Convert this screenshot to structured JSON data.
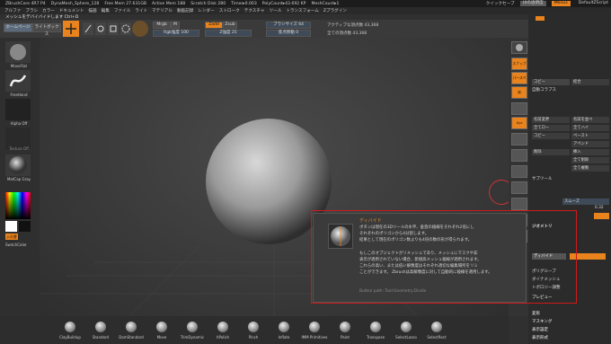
{
  "titlebar": {
    "app": "ZBrushCore 4R7 P4",
    "mesh": "DynaMesh_Sphere_128",
    "free_mem": "Free Mem 27.631GB",
    "active_mem": "Active Mem 188",
    "scratch": "Scratch Disk 280",
    "timer": "Timer▸0.003",
    "polycount": "PolyCount▸43.692 KP",
    "meshcount": "MeshCount▸1",
    "quicksave": "クイックセーブ",
    "seethrough": "UIの透明度",
    "menus_btn": "Menus",
    "script": "DefaultZScript"
  },
  "menubar": [
    "アルファ",
    "ブラシ",
    "カラー",
    "ドキュメント",
    "描画",
    "編集",
    "ファイル",
    "ライト",
    "マテリアル",
    "動画記録",
    "レンダー",
    "ストローク",
    "テクスチャ",
    "ツール",
    "トランスフォーム",
    "Zプラグイン"
  ],
  "notice": "メッシュをデバイバイドします Ctrl+D",
  "toolbar": {
    "home": "ホームページ",
    "lightbox": "ライトボックス",
    "mrgb": "Mrgb",
    "rgb": "Rgb",
    "m": "M",
    "zadd": "Zadd",
    "zsub": "Zsub",
    "rgb_intensity": "Rgb強度 100",
    "z_intensity": "Z強度 25",
    "brush_size": "ブラシサイズ 64",
    "focal_shift": "焦点移動 0",
    "active_points": "アクティブな頂点数 43,368",
    "total_points": "全ての頂点数 43,368"
  },
  "leftpanel": {
    "brush": "MoveFlat",
    "stroke": "FreeHand",
    "alpha": "Alpha Off",
    "texture": "Texture Off",
    "material": "MatCap Gray",
    "gradient": "入れ替え",
    "switch": "SwitchColor"
  },
  "rightshelf": [
    "スナップ",
    "パースペクティブ",
    "床",
    "",
    ""
  ],
  "palette": {
    "tabs": [
      "Ctrl-D",
      "Persp",
      "Floor",
      "Local",
      "Xyz"
    ],
    "rows": [
      {
        "label": "コピー",
        "right": "結合"
      },
      {
        "label": "自動コラプス",
        "right": ""
      },
      {
        "label": "名前変更",
        "right": "名前を並べ"
      },
      {
        "label": "全てロー",
        "right": "全てハイ"
      },
      {
        "label": "コピー",
        "right": "ペースト"
      },
      {
        "label": "",
        "right": "アペンド"
      },
      {
        "label": "削除",
        "right": "挿入"
      },
      {
        "label": "",
        "right": "全て削除"
      },
      {
        "label": "",
        "right": "全て複製"
      }
    ],
    "subtool_section": "サブツール",
    "smooth": "スムーズ",
    "smooth_val": "0.32",
    "geometry": "ジオメトリ",
    "divide": "ディバイド",
    "dynamesh": "ダイナメッシュ",
    "zremesher": "トポロジー調整",
    "polygroup": "ポリグループ",
    "preview": "プレビュー",
    "mask": "マスキング",
    "deform": "変形",
    "visibility": "表示設定",
    "display": "表示形式"
  },
  "bottombar": [
    "ClayBuildup",
    "Standard",
    "DamStandard",
    "Move",
    "TrimDynamic",
    "hPolish",
    "Pinch",
    "Inflate",
    "IMM Primitives",
    "Paint",
    "Transpose",
    "SelectLasso",
    "SelectRect"
  ],
  "tooltip": {
    "title": "ディバイド",
    "line1": "ボタンは現在の3Dツールの水平、垂直の稜線をそれぞれ2倍にし",
    "line2": "それぞれのポリゴンから4分割します。",
    "line3": "結果として現在のポリゴン数よりも4倍の数の形が得られます。",
    "line4": "もしこのオブジェクトがリメッシュであり、メッシュにマスクや非",
    "line5": "表示が適用されていない場合、新規高メッシュ稜線が適用されます。",
    "line6": "これらの高い、または低い解像度はそれぞれ適切な編集場所をリミ",
    "line7": "ことができます。 Zbrushは高解像度に対して自動的に稜線を適用します。",
    "path": "Button path: Tool:Geometry:Divide"
  },
  "colors": {
    "accent": "#e8831d",
    "highlight": "#d0191a"
  }
}
